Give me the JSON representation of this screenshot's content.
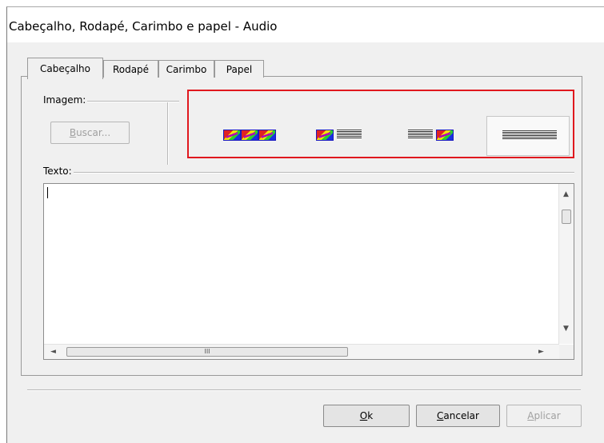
{
  "window": {
    "title": "Cabeçalho, Rodapé, Carimbo e papel - Audio"
  },
  "tabs": [
    {
      "label": "Cabeçalho",
      "active": true
    },
    {
      "label": "Rodapé",
      "active": false
    },
    {
      "label": "Carimbo",
      "active": false
    },
    {
      "label": "Papel",
      "active": false
    }
  ],
  "image_group": {
    "label": "Imagem:",
    "browse_prefix": "",
    "browse_accel": "B",
    "browse_rest": "uscar...",
    "browse_enabled": false,
    "layout_options": [
      {
        "name": "images-only",
        "icon": "three-images-icon",
        "selected": false
      },
      {
        "name": "image-left-text",
        "icon": "image-left-text-icon",
        "selected": false
      },
      {
        "name": "text-image-right",
        "icon": "text-image-right-icon",
        "selected": false
      },
      {
        "name": "text-only",
        "icon": "text-only-icon",
        "selected": true
      }
    ],
    "highlight_color": "#e0181e"
  },
  "text_group": {
    "label": "Texto:",
    "value": "",
    "hscroll_thumb_grip": "III"
  },
  "buttons": {
    "ok_accel": "O",
    "ok_rest": "k",
    "cancel_accel": "C",
    "cancel_rest": "ancelar",
    "apply_accel": "A",
    "apply_rest": "plicar",
    "apply_enabled": false
  }
}
